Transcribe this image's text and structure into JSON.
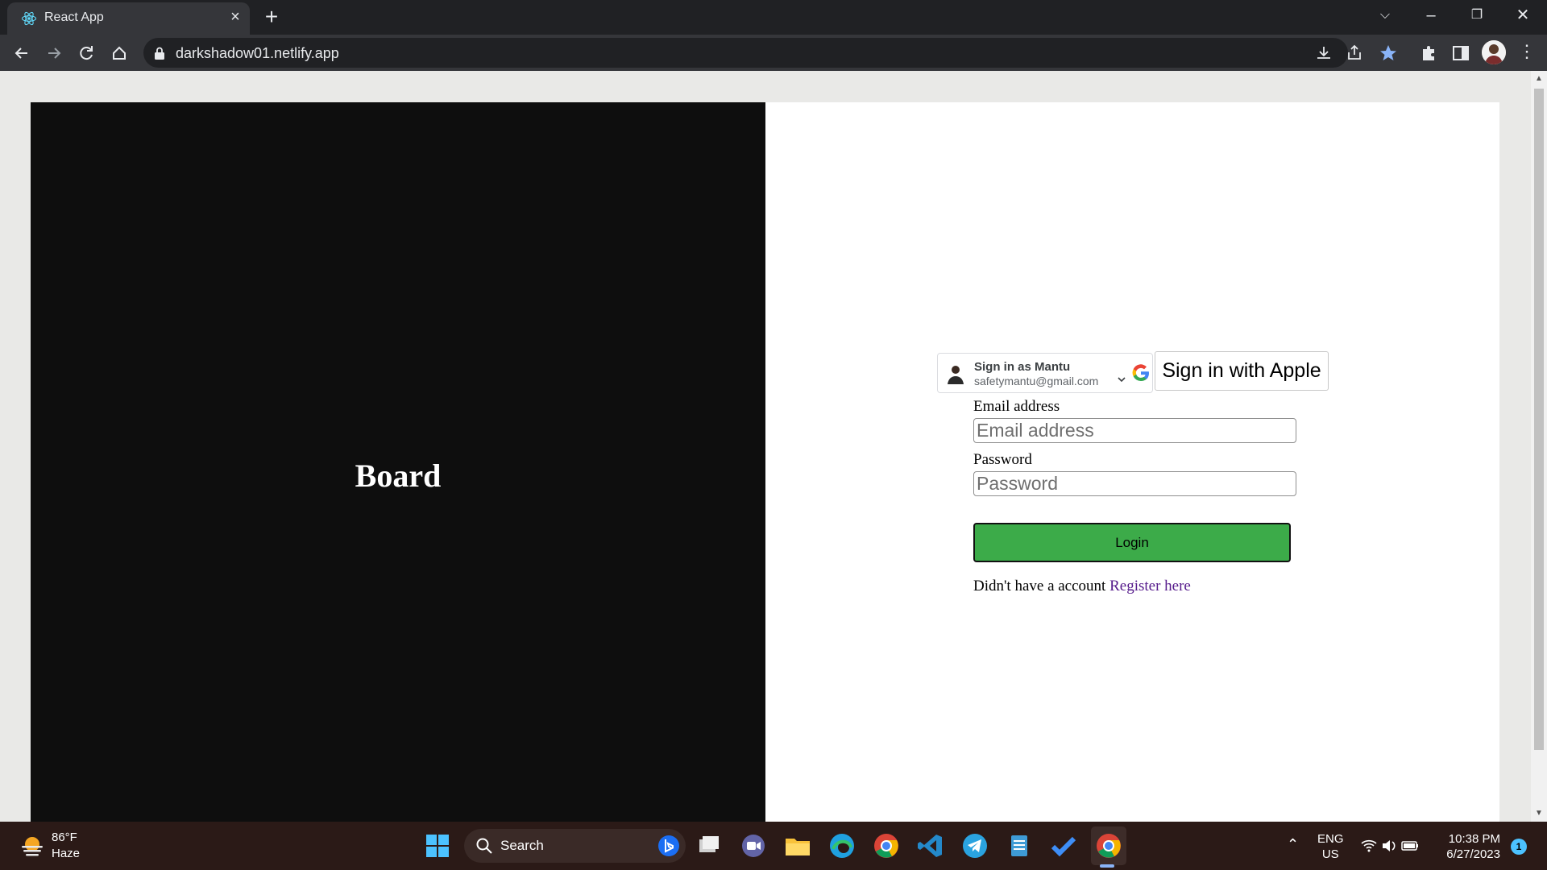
{
  "browser": {
    "tab_title": "React App",
    "url": "darkshadow01.netlify.app"
  },
  "board": {
    "title": "Board"
  },
  "login": {
    "google": {
      "name_line": "Sign in as Mantu",
      "email_line": "safetymantu@gmail.com"
    },
    "apple_button": "Sign in with Apple",
    "email_label": "Email address",
    "email_placeholder": "Email address",
    "email_value": "",
    "password_label": "Password",
    "password_placeholder": "Password",
    "password_value": "",
    "login_button": "Login",
    "register_prefix": "Didn't have a account",
    "register_link": "Register here"
  },
  "taskbar": {
    "weather_temp": "86°F",
    "weather_condition": "Haze",
    "search_label": "Search",
    "lang_line1": "ENG",
    "lang_line2": "US",
    "time": "10:38 PM",
    "date": "6/27/2023",
    "notification_count": "1"
  },
  "colors": {
    "board_bg": "#0e0e0e",
    "login_button_bg": "#3cab49",
    "link_color": "#551a8b",
    "page_bg": "#e9e9e7"
  }
}
